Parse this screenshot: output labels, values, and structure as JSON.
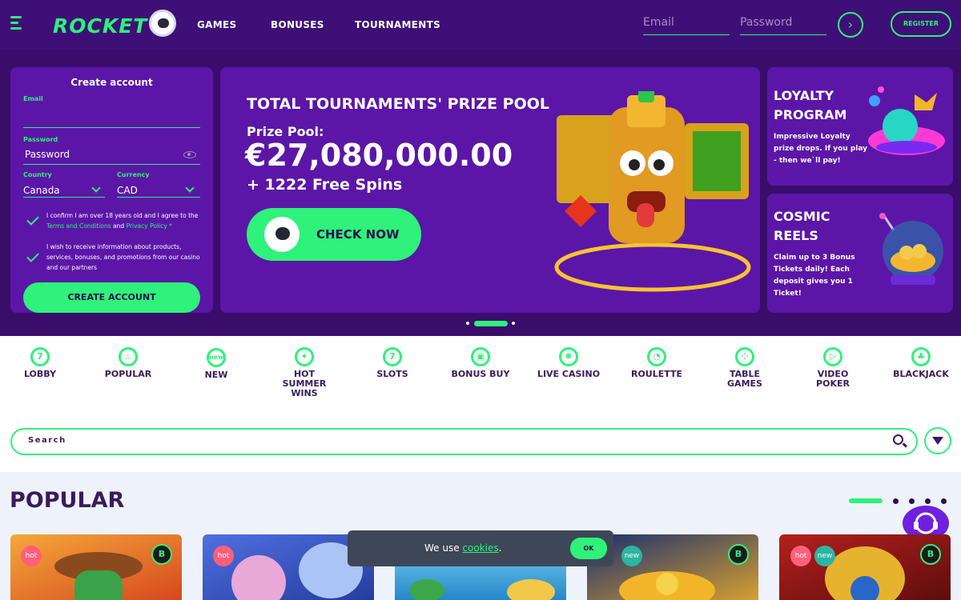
{
  "header": {
    "logo_text": "ROCKET",
    "nav": [
      "GAMES",
      "BONUSES",
      "TOURNAMENTS"
    ],
    "email_placeholder": "Email",
    "password_placeholder": "Password",
    "login_symbol": "›",
    "register_label": "REGISTER"
  },
  "signup": {
    "title": "Create account",
    "email_label": "Email",
    "password_label": "Password",
    "password_value": "Password",
    "country_label": "Country",
    "country_value": "Canada",
    "currency_label": "Currency",
    "currency_value": "CAD",
    "consent_1_a": "I confirm I am over 18 years old and I agree to the ",
    "consent_1_terms": "Terms and Conditions",
    "consent_1_and": " and ",
    "consent_1_privacy": "Privacy Policy",
    "consent_1_star": " *",
    "consent_2": "I wish to receive information about products, services, bonuses, and promotions from our casino and our partners",
    "submit_label": "CREATE ACCOUNT"
  },
  "hero": {
    "title": "TOTAL TOURNAMENTS' PRIZE POOL",
    "subtitle": "Prize Pool:",
    "amount": "€27,080,000.00",
    "spins": "+ 1222 Free Spins",
    "cta": "CHECK NOW"
  },
  "promos": [
    {
      "title_1": "LOYALTY",
      "title_2": "PROGRAM",
      "text": "Impressive Loyalty prize drops. If you play - then we`ll pay!"
    },
    {
      "title_1": "COSMIC",
      "title_2": "REELS",
      "text": "Claim up to 3 Bonus Tickets daily! Each deposit gives you 1 Ticket!"
    }
  ],
  "categories": [
    {
      "label": "LOBBY",
      "icon": "seven-icon",
      "glyph": "7"
    },
    {
      "label": "POPULAR",
      "icon": "fire-icon",
      "glyph": "♨"
    },
    {
      "label": "NEW",
      "icon": "new-icon",
      "glyph": "new"
    },
    {
      "label": "HOT SUMMER WINS",
      "icon": "party-icon",
      "glyph": "✦"
    },
    {
      "label": "SLOTS",
      "icon": "slot-seven-icon",
      "glyph": "7"
    },
    {
      "label": "BONUS BUY",
      "icon": "gift-icon",
      "glyph": "▣"
    },
    {
      "label": "LIVE CASINO",
      "icon": "chip-icon",
      "glyph": "✺"
    },
    {
      "label": "ROULETTE",
      "icon": "roulette-icon",
      "glyph": "◔"
    },
    {
      "label": "TABLE GAMES",
      "icon": "dice-icon",
      "glyph": "⁘"
    },
    {
      "label": "VIDEO POKER",
      "icon": "play-icon",
      "glyph": "▷"
    },
    {
      "label": "BLACKJACK",
      "icon": "club-icon",
      "glyph": "♣"
    }
  ],
  "search": {
    "placeholder": "Search"
  },
  "popular": {
    "title": "POPULAR",
    "cards": [
      {
        "badges": [
          "hot"
        ],
        "btc": "B"
      },
      {
        "badges": [
          "hot"
        ],
        "btc": ""
      },
      {
        "badges": [],
        "btc": ""
      },
      {
        "badges": [
          "new"
        ],
        "btc": "B"
      },
      {
        "badges": [
          "hot",
          "new"
        ],
        "btc": "B"
      }
    ]
  },
  "cookie": {
    "text": "We use ",
    "link": "cookies",
    "dot": ".",
    "ok": "OK"
  },
  "colors": {
    "accent": "#2ef27a",
    "bg_dark": "#3a0d6b",
    "panel": "#5b16a8"
  }
}
